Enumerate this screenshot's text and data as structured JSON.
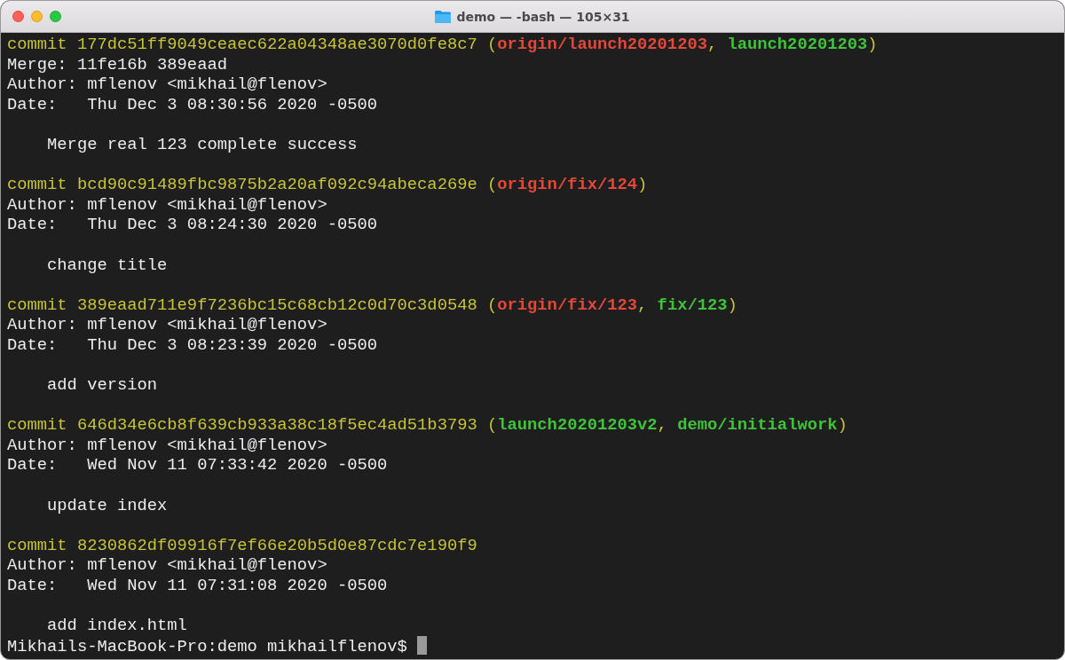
{
  "window": {
    "title": "demo — -bash — 105×31"
  },
  "terminal": {
    "lines": [
      {
        "kind": "text",
        "segments": [
          {
            "text": "commit 177dc51ff9049ceaec622a04348ae3070d0fe8c7",
            "kind": "hash"
          },
          {
            "text": "(",
            "kind": "punct",
            "space_before": true
          },
          {
            "text": "origin/launch20201203",
            "kind": "remote"
          },
          {
            "text": ",",
            "kind": "punct"
          },
          {
            "text": "launch20201203",
            "kind": "local",
            "space_before": true
          },
          {
            "text": ")",
            "kind": "punct"
          }
        ]
      },
      {
        "kind": "text",
        "segments": [
          {
            "text": "Merge: 11fe16b 389eaad",
            "kind": "plain"
          }
        ]
      },
      {
        "kind": "text",
        "segments": [
          {
            "text": "Author: mflenov <mikhail@flenov>",
            "kind": "plain"
          }
        ]
      },
      {
        "kind": "text",
        "segments": [
          {
            "text": "Date:   Thu Dec 3 08:30:56 2020 -0500",
            "kind": "plain"
          }
        ]
      },
      {
        "kind": "blank"
      },
      {
        "kind": "message",
        "segments": [
          {
            "text": "Merge real 123 complete success",
            "kind": "plain"
          }
        ]
      },
      {
        "kind": "blank"
      },
      {
        "kind": "text",
        "segments": [
          {
            "text": "commit bcd90c91489fbc9875b2a20af092c94abeca269e",
            "kind": "hash"
          },
          {
            "text": "(",
            "kind": "punct",
            "space_before": true
          },
          {
            "text": "origin/fix/124",
            "kind": "remote"
          },
          {
            "text": ")",
            "kind": "punct"
          }
        ]
      },
      {
        "kind": "text",
        "segments": [
          {
            "text": "Author: mflenov <mikhail@flenov>",
            "kind": "plain"
          }
        ]
      },
      {
        "kind": "text",
        "segments": [
          {
            "text": "Date:   Thu Dec 3 08:24:30 2020 -0500",
            "kind": "plain"
          }
        ]
      },
      {
        "kind": "blank"
      },
      {
        "kind": "message",
        "segments": [
          {
            "text": "change title",
            "kind": "plain"
          }
        ]
      },
      {
        "kind": "blank"
      },
      {
        "kind": "text",
        "segments": [
          {
            "text": "commit 389eaad711e9f7236bc15c68cb12c0d70c3d0548",
            "kind": "hash"
          },
          {
            "text": "(",
            "kind": "punct",
            "space_before": true
          },
          {
            "text": "origin/fix/123",
            "kind": "remote"
          },
          {
            "text": ",",
            "kind": "punct"
          },
          {
            "text": "fix/123",
            "kind": "local",
            "space_before": true
          },
          {
            "text": ")",
            "kind": "punct"
          }
        ]
      },
      {
        "kind": "text",
        "segments": [
          {
            "text": "Author: mflenov <mikhail@flenov>",
            "kind": "plain"
          }
        ]
      },
      {
        "kind": "text",
        "segments": [
          {
            "text": "Date:   Thu Dec 3 08:23:39 2020 -0500",
            "kind": "plain"
          }
        ]
      },
      {
        "kind": "blank"
      },
      {
        "kind": "message",
        "segments": [
          {
            "text": "add version",
            "kind": "plain"
          }
        ]
      },
      {
        "kind": "blank"
      },
      {
        "kind": "text",
        "segments": [
          {
            "text": "commit 646d34e6cb8f639cb933a38c18f5ec4ad51b3793",
            "kind": "hash"
          },
          {
            "text": "(",
            "kind": "punct",
            "space_before": true
          },
          {
            "text": "launch20201203v2",
            "kind": "local"
          },
          {
            "text": ",",
            "kind": "punct"
          },
          {
            "text": "demo/initialwork",
            "kind": "local",
            "space_before": true
          },
          {
            "text": ")",
            "kind": "punct"
          }
        ]
      },
      {
        "kind": "text",
        "segments": [
          {
            "text": "Author: mflenov <mikhail@flenov>",
            "kind": "plain"
          }
        ]
      },
      {
        "kind": "text",
        "segments": [
          {
            "text": "Date:   Wed Nov 11 07:33:42 2020 -0500",
            "kind": "plain"
          }
        ]
      },
      {
        "kind": "blank"
      },
      {
        "kind": "message",
        "segments": [
          {
            "text": "update index",
            "kind": "plain"
          }
        ]
      },
      {
        "kind": "blank"
      },
      {
        "kind": "text",
        "segments": [
          {
            "text": "commit 8230862df09916f7ef66e20b5d0e87cdc7e190f9",
            "kind": "hash"
          }
        ]
      },
      {
        "kind": "text",
        "segments": [
          {
            "text": "Author: mflenov <mikhail@flenov>",
            "kind": "plain"
          }
        ]
      },
      {
        "kind": "text",
        "segments": [
          {
            "text": "Date:   Wed Nov 11 07:31:08 2020 -0500",
            "kind": "plain"
          }
        ]
      },
      {
        "kind": "blank"
      },
      {
        "kind": "message",
        "segments": [
          {
            "text": "add index.html",
            "kind": "plain"
          }
        ]
      }
    ],
    "prompt": "Mikhails-MacBook-Pro:demo mikhailflenov$"
  }
}
